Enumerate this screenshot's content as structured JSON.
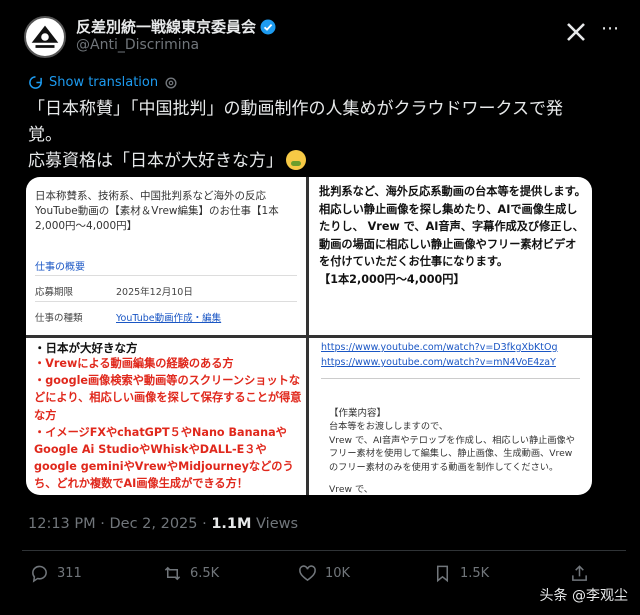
{
  "author": {
    "display_name": "反差別統一戦線東京委員会",
    "handle": "@Anti_Discrimina"
  },
  "translate": {
    "label": "Show translation"
  },
  "tweet": {
    "lines": [
      "「日本称賛」「中国批判」の動画制作の人集めがクラウドワークスで発",
      "覚。",
      "応募資格は「日本が大好きな方」"
    ],
    "emoji": "nauseated-face"
  },
  "media": {
    "panel1": {
      "job_title": "日本称賛系、技術系、中国批判系など海外の反応YouTube動画の【素材＆Vrew編集】のお仕事【1本2,000円〜4,000円】",
      "overview_link": "仕事の概要",
      "rows": [
        {
          "label": "応募期限",
          "value": "2025年12月10日"
        },
        {
          "label": "仕事の種類",
          "value": "YouTube動画作成・編集"
        }
      ]
    },
    "panel2": {
      "text": "批判系など、海外反応系動画の台本等を提供します。\n相応しい静止画像を探し集めたり、AIで画像生成したりし、 Vrew で、AI音声、字幕作成及び修正し、動画の場面に相応しい静止画像やフリー素材ビデオを付けていただくお仕事になります。\n【1本2,000円〜4,000円】"
    },
    "panel3": {
      "title": "・日本が大好きな方",
      "text": "・Vrewによる動画編集の経験のある方\n・google画像検索や動画等のスクリーンショットなどにより、相応しい画像を探して保存することが得意な方\n・イメージFXやchatGPT５やNano BananaやGoogle Ai StudioやWhiskやDALL-E３やgoogle geminiやVrewやMidjourneyなどのうち、どれか複数でAI画像生成ができる方！\n・素材をしっかりとやっていただける方でご応"
    },
    "panel4": {
      "links": [
        "https://www.youtube.com/watch?v=D3fkgXbKtOg",
        "https://www.youtube.com/watch?v=mN4VoE4zaY"
      ],
      "work_label": "【作業内容】",
      "work_body": "台本等をお渡ししますので、\nVrew で、AI音声やテロップを作成し、相応しい静止画像やフリー素材を使用して編集し、静止画像、生成動画、Vrewのフリー素材のみを使用する動画を制作してください。",
      "vrew_line": "Vrew で、"
    }
  },
  "meta": {
    "timestamp": "12:13 PM · Dec 2, 2025 · ",
    "views_count": "1.1M",
    "views_label": " Views"
  },
  "actions": {
    "replies": "311",
    "reposts": "6.5K",
    "likes": "10K",
    "bookmarks": "1.5K"
  },
  "watermark": "头条 @李观尘",
  "colors": {
    "link_blue": "#1d9bf0",
    "muted": "#71767b",
    "red_text": "#e0281c"
  }
}
